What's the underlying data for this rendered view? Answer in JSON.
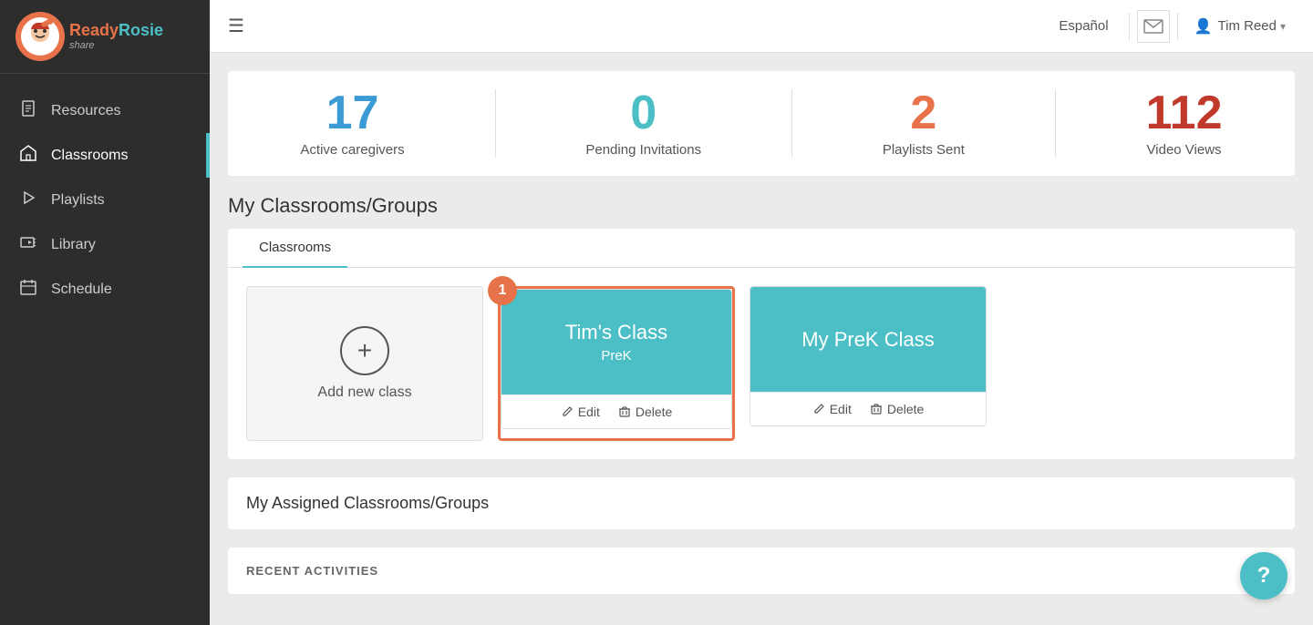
{
  "topbar": {
    "hamburger_icon": "☰",
    "language_btn": "Español",
    "mail_icon": "✉",
    "user_name": "Tim Reed",
    "user_chevron": "▾"
  },
  "sidebar": {
    "logo_text": "ReadyRosie",
    "logo_sub": "share",
    "nav_items": [
      {
        "id": "resources",
        "label": "Resources",
        "icon": "📄"
      },
      {
        "id": "classrooms",
        "label": "Classrooms",
        "icon": "★",
        "active": true
      },
      {
        "id": "playlists",
        "label": "Playlists",
        "icon": "▶"
      },
      {
        "id": "library",
        "label": "Library",
        "icon": "🎥"
      },
      {
        "id": "schedule",
        "label": "Schedule",
        "icon": "📅"
      }
    ]
  },
  "stats": {
    "active_caregivers": {
      "number": "17",
      "label": "Active caregivers",
      "color_class": "blue"
    },
    "pending_invitations": {
      "number": "0",
      "label": "Pending Invitations",
      "color_class": "teal"
    },
    "playlists_sent": {
      "number": "2",
      "label": "Playlists Sent",
      "color_class": "orange"
    },
    "video_views": {
      "number": "112",
      "label": "Video Views",
      "color_class": "red"
    }
  },
  "my_classrooms": {
    "section_title": "My Classrooms/Groups",
    "tab_label": "Classrooms",
    "add_new_label": "Add new class",
    "classes": [
      {
        "name": "Tim's Class",
        "grade": "PreK",
        "highlighted": true,
        "badge": "1",
        "edit_label": "Edit",
        "delete_label": "Delete"
      },
      {
        "name": "My PreK Class",
        "grade": "",
        "highlighted": false,
        "badge": "",
        "edit_label": "Edit",
        "delete_label": "Delete"
      }
    ]
  },
  "assigned_section": {
    "title": "My Assigned Classrooms/Groups"
  },
  "recent_section": {
    "title": "RECENT ACTIVITIES"
  },
  "help_btn": "?"
}
